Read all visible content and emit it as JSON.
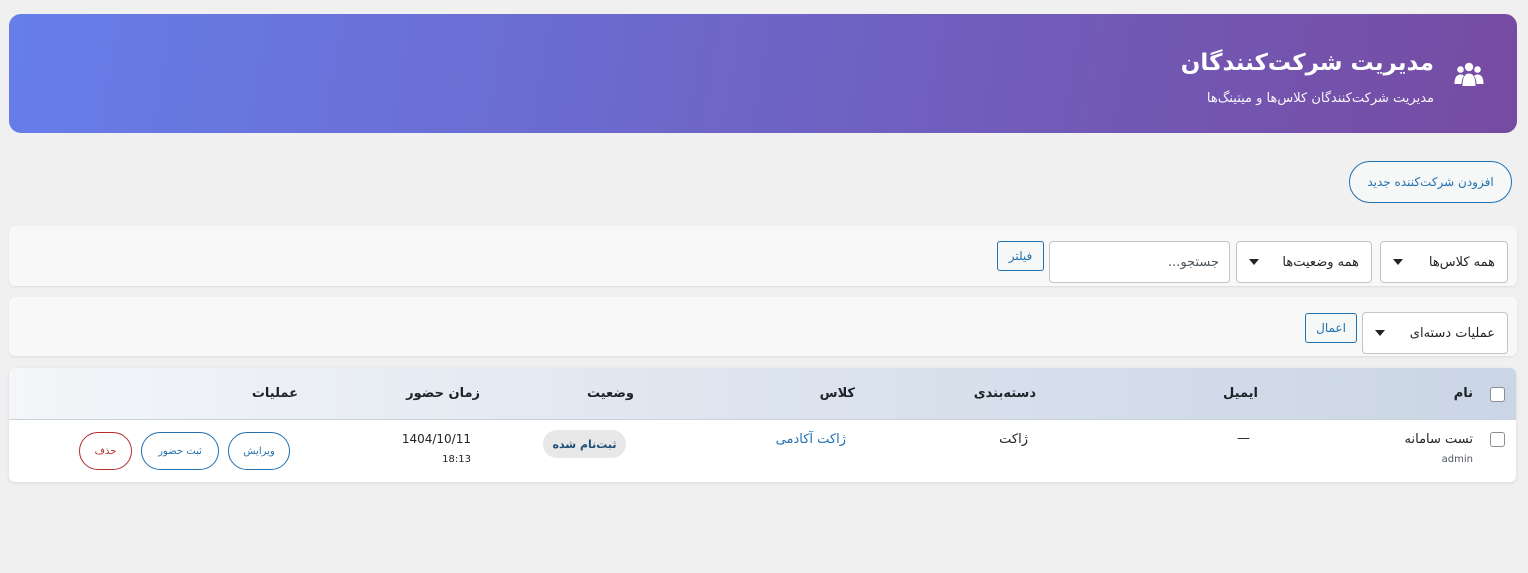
{
  "header": {
    "title": "مدیریت شرکت‌کنندگان",
    "subtitle": "مدیریت شرکت‌کنندگان کلاس‌ها و میتینگ‌ها",
    "icon": "users-icon",
    "gradient": [
      "#667eea",
      "#764ba2"
    ]
  },
  "actions": {
    "add_label": "افزودن شرکت‌کننده جدید"
  },
  "filters": {
    "class_select": "همه کلاس‌ها",
    "status_select": "همه وضعیت‌ها",
    "search_placeholder": "جستجو...",
    "filter_button": "فیلتر"
  },
  "bulk": {
    "select": "عملیات دسته‌ای",
    "apply_button": "اعمال"
  },
  "table": {
    "columns": [
      "نام",
      "ایمیل",
      "دسته‌بندی",
      "کلاس",
      "وضعیت",
      "زمان حضور",
      "عملیات"
    ],
    "rows": [
      {
        "name": "تست سامانه",
        "username": "admin",
        "email": "—",
        "category": "ژاکت",
        "class": "ژاکت آکادمی",
        "status": "ثبت‌نام شده",
        "date": "1404/10/11",
        "time": "18:13",
        "actions": {
          "edit": "ویرایش",
          "attendance": "ثبت حضور",
          "delete": "حذف"
        }
      }
    ]
  },
  "colors": {
    "primary": "#2271b1",
    "danger": "#b32d2e",
    "background": "#f0f0f1"
  }
}
